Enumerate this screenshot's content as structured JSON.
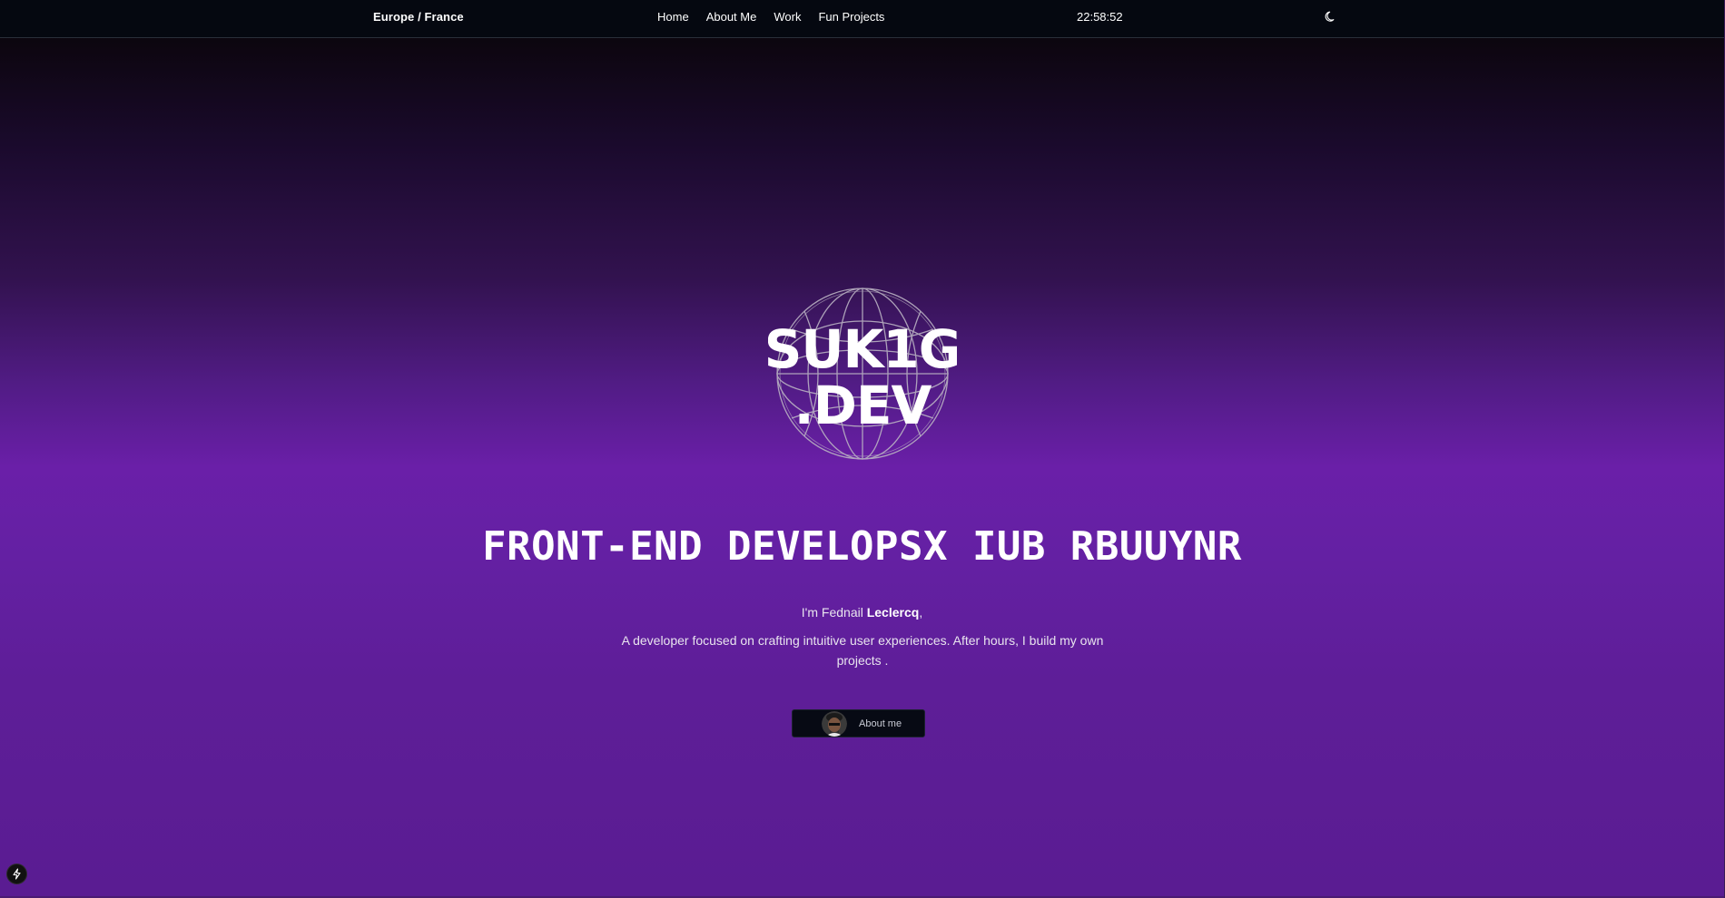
{
  "header": {
    "location": "Europe / France",
    "nav": [
      {
        "label": "Home"
      },
      {
        "label": "About Me"
      },
      {
        "label": "Work"
      },
      {
        "label": "Fun Projects"
      }
    ],
    "clock": "22:58:52",
    "theme_icon": "moon-icon"
  },
  "hero": {
    "logo": {
      "line1": "SUK1G",
      "line2": ".DEV",
      "icon": "globe-icon"
    },
    "headline": "FRONT-END DEVELOPSX IUB RBUUYNR",
    "intro_prefix": "I'm Fednail ",
    "intro_name": "Leclercq",
    "intro_suffix": ",",
    "description": "A developer focused on crafting intuitive user experiences. After hours, I build my own projects .",
    "button_label": "About me",
    "button_icon": "avatar"
  },
  "dev_indicator": {
    "icon": "lightning-icon"
  },
  "colors": {
    "purple_mid": "#6a1fa8",
    "topbar": "#050810",
    "button": "#070a14"
  }
}
